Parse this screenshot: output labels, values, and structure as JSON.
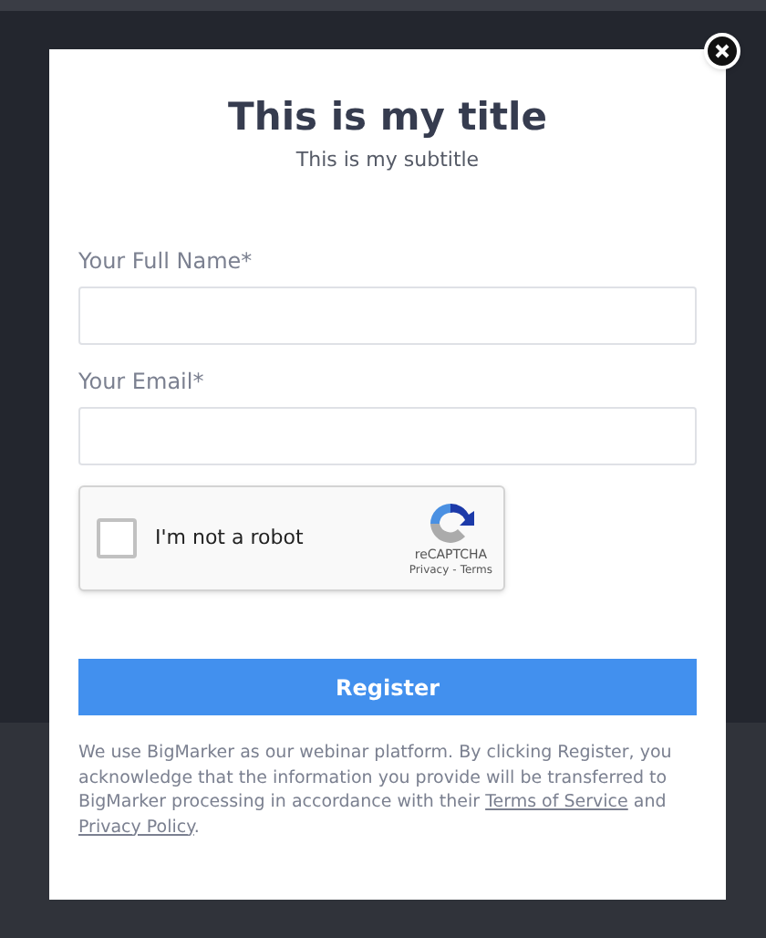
{
  "modal": {
    "title": "This is my title",
    "subtitle": "This is my subtitle",
    "fields": [
      {
        "label": "Your Full Name*"
      },
      {
        "label": "Your Email*"
      }
    ],
    "captcha": {
      "label": "I'm not a robot",
      "checked": false,
      "brand": "reCAPTCHA",
      "privacy": "Privacy",
      "separator": "-",
      "terms": "Terms"
    },
    "submit": "Register",
    "disclaimer": [
      {
        "kind": "text",
        "text": "We use BigMarker as our webinar platform. By clicking Register, you acknowledge that the information you provide will be transferred to BigMarker processing in accordance with their "
      },
      {
        "kind": "link",
        "text": "Terms of Service"
      },
      {
        "kind": "text",
        "text": " and "
      },
      {
        "kind": "link",
        "text": "Privacy Policy"
      },
      {
        "kind": "text",
        "text": "."
      }
    ]
  }
}
